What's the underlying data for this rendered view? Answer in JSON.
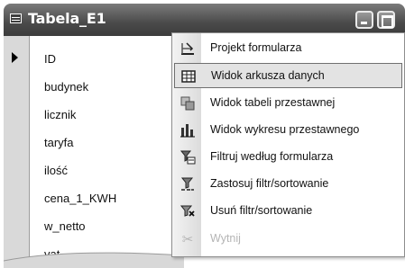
{
  "window": {
    "title": "Tabela_E1"
  },
  "fields": [
    "ID",
    "budynek",
    "licznik",
    "taryfa",
    "ilość",
    "cena_1_KWH",
    "w_netto",
    "vat"
  ],
  "context_menu": {
    "items": [
      {
        "label": "Projekt formularza",
        "icon": "design-view-icon",
        "enabled": true
      },
      {
        "label": "Widok arkusza danych",
        "icon": "datasheet-view-icon",
        "enabled": true,
        "active": true
      },
      {
        "label": "Widok tabeli przestawnej",
        "icon": "pivot-table-icon",
        "enabled": true
      },
      {
        "label": "Widok wykresu przestawnego",
        "icon": "pivot-chart-icon",
        "enabled": true
      },
      {
        "label": "Filtruj według formularza",
        "icon": "filter-by-form-icon",
        "enabled": true
      },
      {
        "label": "Zastosuj filtr/sortowanie",
        "icon": "apply-filter-icon",
        "enabled": true
      },
      {
        "label": "Usuń filtr/sortowanie",
        "icon": "remove-filter-icon",
        "enabled": true
      },
      {
        "label": "Wytnij",
        "icon": "cut-icon",
        "enabled": false
      }
    ]
  }
}
